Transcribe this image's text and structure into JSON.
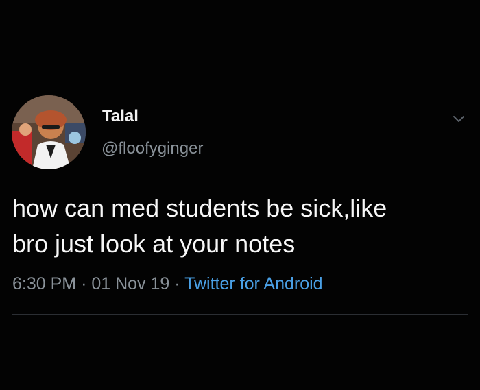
{
  "tweet": {
    "display_name": "Talal",
    "handle": "@floofyginger",
    "text_line1": "how can med students be sick,like",
    "text_line2": "bro just look at your notes",
    "time": "6:30 PM",
    "date": "01 Nov 19",
    "separator": "·",
    "source": "Twitter for Android"
  },
  "icons": {
    "caret": "chevron-down-icon",
    "avatar": "profile-photo"
  },
  "colors": {
    "background": "#030303",
    "primary_text": "#f5f5f5",
    "secondary_text": "#8a9299",
    "link": "#4aa0e6",
    "divider": "#2b2e33"
  }
}
